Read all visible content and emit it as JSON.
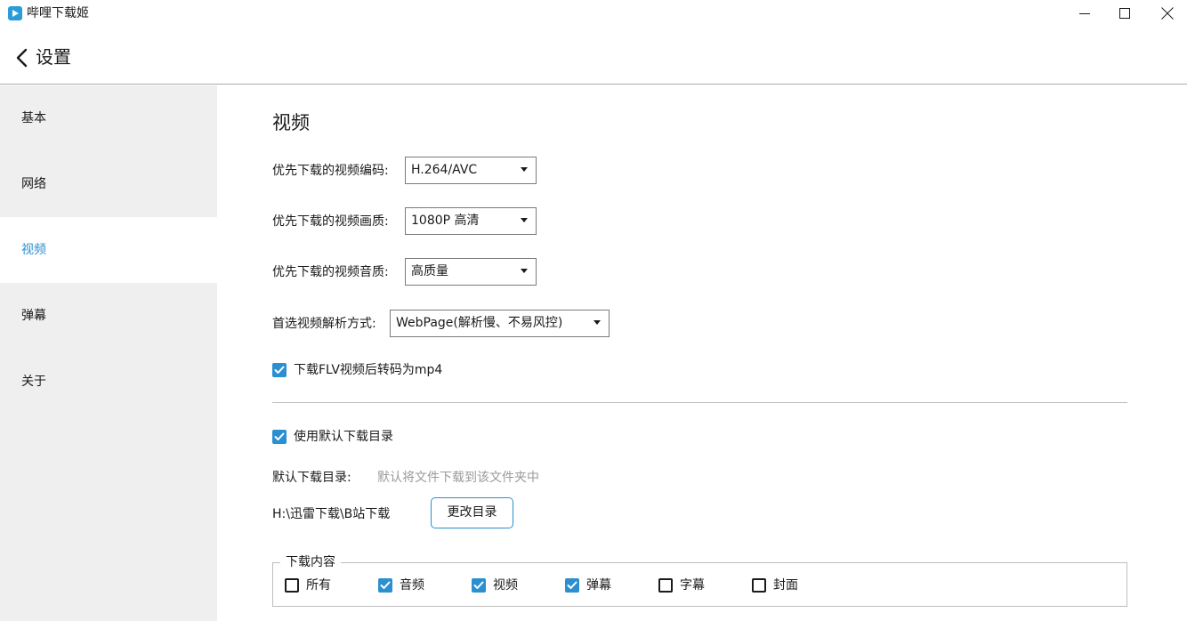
{
  "window": {
    "title": "哔哩下载姬"
  },
  "header": {
    "title": "设置"
  },
  "sidebar": {
    "items": [
      {
        "label": "基本",
        "active": false
      },
      {
        "label": "网络",
        "active": false
      },
      {
        "label": "视频",
        "active": true
      },
      {
        "label": "弹幕",
        "active": false
      },
      {
        "label": "关于",
        "active": false
      }
    ]
  },
  "video": {
    "section_title": "视频",
    "codec": {
      "label": "优先下载的视频编码:",
      "value": "H.264/AVC"
    },
    "quality": {
      "label": "优先下载的视频画质:",
      "value": "1080P 高清"
    },
    "audio": {
      "label": "优先下载的视频音质:",
      "value": "高质量"
    },
    "parse": {
      "label": "首选视频解析方式:",
      "value": "WebPage(解析慢、不易风控)"
    },
    "flv_to_mp4": {
      "label": "下载FLV视频后转码为mp4",
      "checked": true
    }
  },
  "directory": {
    "use_default": {
      "label": "使用默认下载目录",
      "checked": true
    },
    "default_label": "默认下载目录:",
    "default_hint": "默认将文件下载到该文件夹中",
    "path": "H:\\迅雷下载\\B站下载",
    "change_button": "更改目录"
  },
  "download_content": {
    "legend": "下载内容",
    "options": [
      {
        "label": "所有",
        "checked": false
      },
      {
        "label": "音频",
        "checked": true
      },
      {
        "label": "视频",
        "checked": true
      },
      {
        "label": "弹幕",
        "checked": true
      },
      {
        "label": "字幕",
        "checked": false
      },
      {
        "label": "封面",
        "checked": false
      }
    ]
  },
  "colors": {
    "accent": "#2b8fd0",
    "sidebar_bg": "#efefef",
    "hint_text": "#9a9a9a"
  }
}
